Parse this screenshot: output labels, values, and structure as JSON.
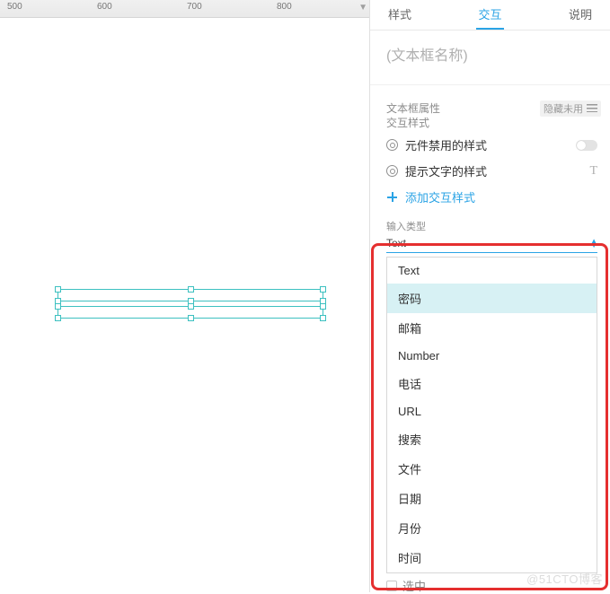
{
  "ruler": {
    "ticks": [
      "500",
      "600",
      "700",
      "800"
    ]
  },
  "tabs": {
    "style": "样式",
    "interact": "交互",
    "notes": "说明"
  },
  "name_placeholder": "(文本框名称)",
  "sections": {
    "text_props": "文本框属性",
    "hide_unused": "隐藏未用",
    "interact_style": "交互样式",
    "disabled_style": "元件禁用的样式",
    "hint_style": "提示文字的样式",
    "add_style": "添加交互样式"
  },
  "input_type": {
    "label": "输入类型",
    "value": "Text"
  },
  "dropdown": {
    "items": [
      "Text",
      "密码",
      "邮箱",
      "Number",
      "电话",
      "URL",
      "搜索",
      "文件",
      "日期",
      "月份",
      "时间"
    ],
    "hovered_index": 1
  },
  "under_row": "选中",
  "watermark": "@51CTO博客"
}
